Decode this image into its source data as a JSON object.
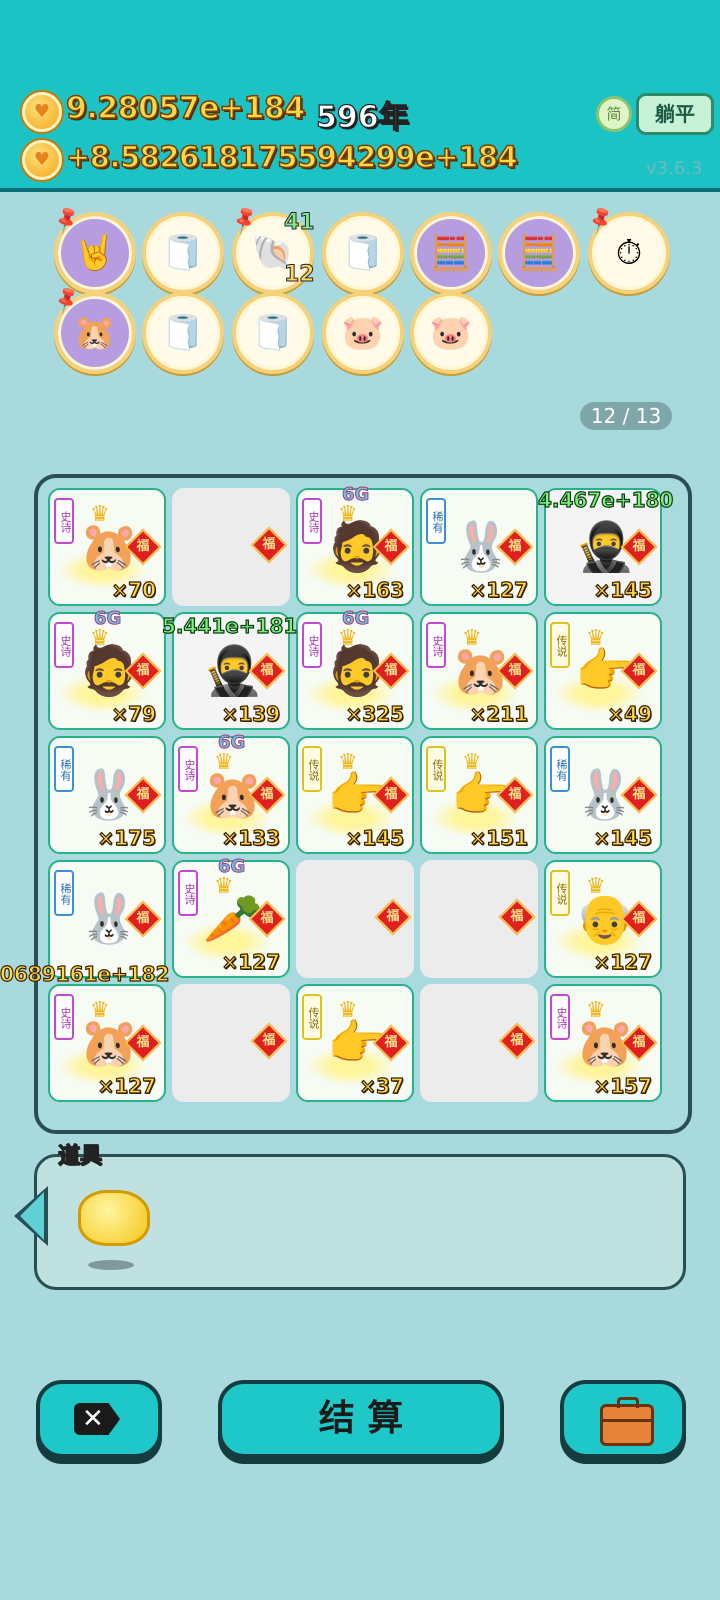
{
  "header": {
    "coins": "9.28057e+184",
    "year": "596年",
    "income": "+8.582618175594299e+184",
    "simplified_label": "简",
    "flat_button": "躺平",
    "version": "v3.6.3"
  },
  "collection": {
    "medals": [
      {
        "icon": "rock-hand-icon",
        "glyph": "🤘"
      },
      {
        "icon": "tissue-box-icon",
        "glyph": "🧻"
      },
      {
        "icon": "shell-icon",
        "glyph": "🐚",
        "top_count": "41",
        "bottom_count": "12"
      },
      {
        "icon": "tissue-box-icon",
        "glyph": "🧻"
      },
      {
        "icon": "math-guy-icon",
        "glyph": "🧮"
      },
      {
        "icon": "math-guy-icon",
        "glyph": "🧮"
      },
      {
        "icon": "time-card-icon",
        "glyph": "⏱"
      },
      {
        "icon": "hamsters-icon",
        "glyph": "🐹"
      },
      {
        "icon": "tissue-box-icon",
        "glyph": "🧻"
      },
      {
        "icon": "tissue-box-icon",
        "glyph": "🧻"
      },
      {
        "icon": "piggy-bank-icon",
        "glyph": "🐷"
      },
      {
        "icon": "piggy-bank-icon",
        "glyph": "🐷"
      }
    ],
    "pager": "12 / 13"
  },
  "board": {
    "fu": "福",
    "rarity": {
      "epic": "史诗",
      "rare": "稀有",
      "leg": "传说"
    },
    "cells": [
      {
        "kind": "hamster",
        "rar": "epic",
        "count": "×70"
      },
      {
        "kind": "empty"
      },
      {
        "kind": "old-man",
        "rar": "epic",
        "count": "×163",
        "sixg": "6G"
      },
      {
        "kind": "rabbit",
        "rar": "rare",
        "count": "×127"
      },
      {
        "kind": "thief",
        "count": "×145"
      },
      {
        "kind": "old-man",
        "rar": "epic",
        "count": "×79",
        "sixg": "6G"
      },
      {
        "kind": "thief",
        "count": "×139"
      },
      {
        "kind": "old-man",
        "rar": "epic",
        "count": "×325",
        "sixg": "6G"
      },
      {
        "kind": "hamster",
        "rar": "epic",
        "count": "×211"
      },
      {
        "kind": "hand",
        "rar": "leg",
        "count": "×49"
      },
      {
        "kind": "rabbit",
        "rar": "rare",
        "count": "×175"
      },
      {
        "kind": "hamster",
        "rar": "epic",
        "count": "×133",
        "sixg": "6G"
      },
      {
        "kind": "hand",
        "rar": "leg",
        "count": "×145"
      },
      {
        "kind": "hand",
        "rar": "leg",
        "count": "×151"
      },
      {
        "kind": "rabbit",
        "rar": "rare",
        "count": "×145"
      },
      {
        "kind": "rabbit",
        "rar": "rare",
        "count": ""
      },
      {
        "kind": "carrot",
        "rar": "epic",
        "count": "×127",
        "sixg": "6G"
      },
      {
        "kind": "empty"
      },
      {
        "kind": "empty"
      },
      {
        "kind": "grandpa",
        "rar": "leg",
        "count": "×127"
      },
      {
        "kind": "hamster",
        "rar": "epic",
        "count": "×127"
      },
      {
        "kind": "empty"
      },
      {
        "kind": "hand",
        "rar": "leg",
        "count": "×37"
      },
      {
        "kind": "empty"
      },
      {
        "kind": "hamster",
        "rar": "epic",
        "count": "×157"
      }
    ],
    "floating": [
      "4.467e+180",
      "5.441e+181",
      "0689161e+182"
    ]
  },
  "items": {
    "title": "道具",
    "entries": [
      {
        "icon": "golden-piggy-icon"
      }
    ]
  },
  "actions": {
    "settle_label": "结 算",
    "delete_icon": "delete-tag-icon",
    "bag_icon": "briefcase-icon"
  }
}
